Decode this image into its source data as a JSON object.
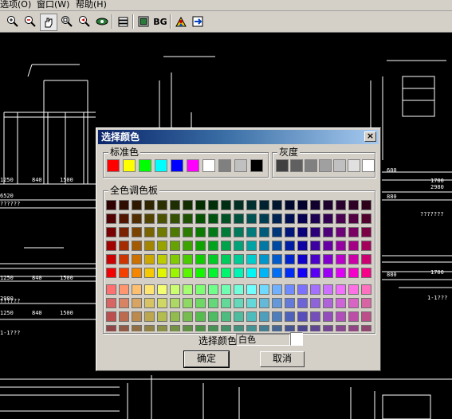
{
  "menubar": {
    "items": [
      "选项(O)",
      "窗口(W)",
      "帮助(H)"
    ]
  },
  "toolbar": {
    "icons": [
      "zoom-in-icon",
      "zoom-out-icon",
      "pan-hand-icon",
      "zoom-window-icon",
      "zoom-previous-icon",
      "view-eye-icon",
      "layers-icon",
      "display-icon",
      "background-icon",
      "user-icon",
      "export-icon"
    ],
    "bg_label": "BG"
  },
  "drawing": {
    "dim_labels": [
      "6520",
      "1250",
      "840",
      "1500",
      "1250",
      "840",
      "1500",
      "2980",
      "1250",
      "840",
      "1500",
      "2980",
      "1700",
      "1700",
      "880",
      "880",
      "600"
    ],
    "notes": [
      "??????",
      "???????",
      "??????",
      "1-1???",
      "1-1???"
    ]
  },
  "dialog": {
    "title": "选择颜色",
    "close_label": "×",
    "standard_group": "标准色",
    "gray_group": "灰度",
    "palette_group": "全色调色板",
    "standard_colors": [
      "#ff0000",
      "#ffff00",
      "#00ff00",
      "#00ffff",
      "#0000ff",
      "#ff00ff",
      "#ffffff",
      "#808080",
      "#c0c0c0",
      "#000000"
    ],
    "gray_colors": [
      "#404040",
      "#606060",
      "#808080",
      "#a0a0a0",
      "#c0c0c0",
      "#e0e0e0",
      "#ffffff"
    ],
    "selected_label": "选择颜色",
    "selected_value": "白色",
    "selected_color": "#ffffff",
    "ok_label": "确定",
    "cancel_label": "取消"
  }
}
